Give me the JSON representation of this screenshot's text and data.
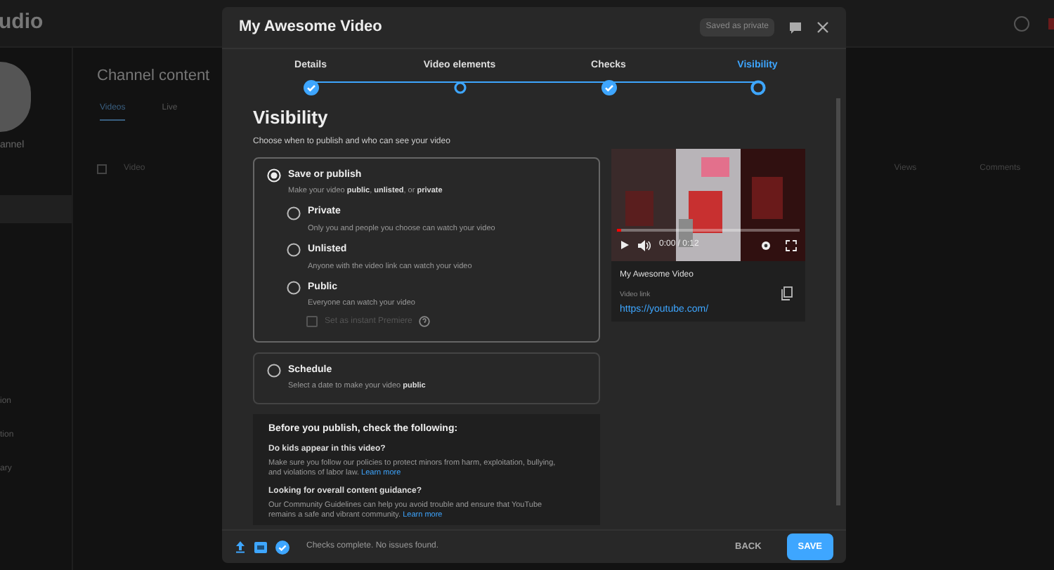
{
  "background": {
    "logo_text": "udio",
    "channel_name": "annel",
    "select_all_checked": false,
    "sidebar_items": [
      "ion",
      "tion",
      "ary"
    ],
    "page_title": "Channel content",
    "tabs": [
      {
        "label": "Videos",
        "selected": true
      },
      {
        "label": "Live",
        "selected": false
      }
    ],
    "table_columns": [
      "Video",
      "Views",
      "Comments"
    ]
  },
  "dialog": {
    "title": "My Awesome Video",
    "save_status": "Saved as private",
    "steps": [
      {
        "label": "Details",
        "completed": true,
        "selected": false
      },
      {
        "label": "Video elements",
        "completed": false,
        "selected": false
      },
      {
        "label": "Checks",
        "completed": true,
        "selected": false
      },
      {
        "label": "Visibility",
        "completed": false,
        "selected": true
      }
    ],
    "heading": "Visibility",
    "subtitle": "Choose when to publish and who can see your video",
    "save_or_publish": {
      "label": "Save or publish",
      "description": "Make your video **public**, **unlisted**, or **private**",
      "selected": true,
      "options": [
        {
          "label": "Private",
          "description": "Only you and people you choose can watch your video",
          "selected": false
        },
        {
          "label": "Unlisted",
          "description": "Anyone with the video link can watch your video",
          "selected": false
        },
        {
          "label": "Public",
          "description": "Everyone can watch your video",
          "selected": false
        }
      ],
      "premiere": {
        "label": "Set as instant Premiere",
        "checked": false,
        "disabled": true
      }
    },
    "schedule": {
      "label": "Schedule",
      "description": "Select a date to make your video **public**",
      "selected": false
    },
    "checklist": {
      "title": "Before you publish, check the following:",
      "items": [
        {
          "question": "Do kids appear in this video?",
          "text": "Make sure you follow our policies to protect minors from harm, exploitation, bullying, and violations of labor law.",
          "link": "Learn more"
        },
        {
          "question": "Looking for overall content guidance?",
          "text": "Our Community Guidelines can help you avoid trouble and ensure that YouTube remains a safe and vibrant community.",
          "link": "Learn more"
        }
      ]
    },
    "preview": {
      "time": "0:00 / 0:12",
      "level": 0.02,
      "video_title": "My Awesome Video",
      "link_label": "Video link",
      "link": "https://youtube.com/"
    },
    "footer": {
      "status": "Checks complete. No issues found.",
      "back": "BACK",
      "save": "SAVE"
    }
  }
}
